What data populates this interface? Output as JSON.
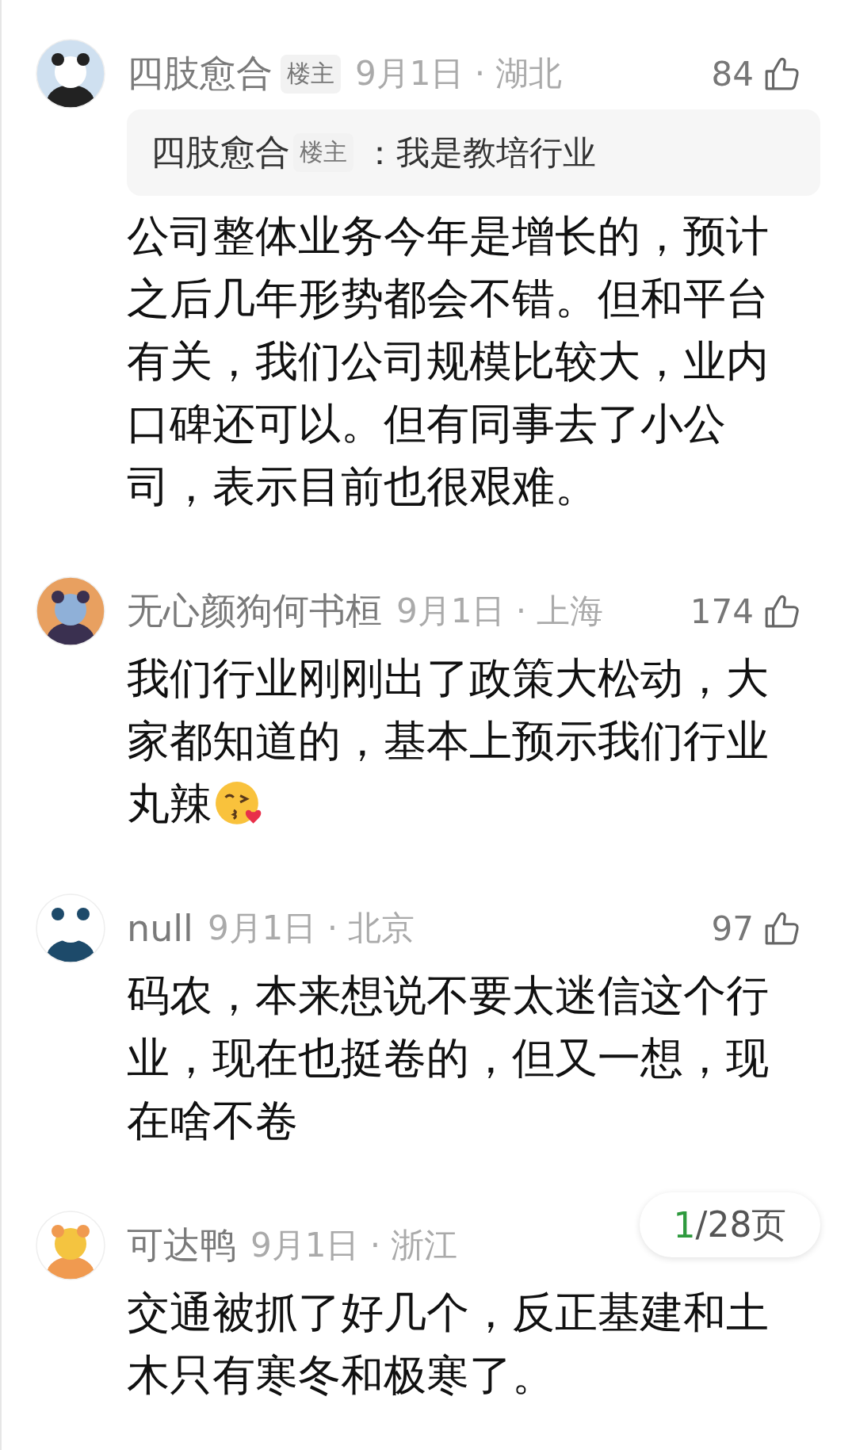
{
  "comments": [
    {
      "author": "四肢愈合",
      "badge": "楼主",
      "meta": "9月1日 · 湖北",
      "likes": "84",
      "quote": {
        "author": "四肢愈合",
        "badge": "楼主",
        "text": "：我是教培行业"
      },
      "body": "公司整体业务今年是增长的，预计之后几年形势都会不错。但和平台有关，我们公司规模比较大，业内口碑还可以。但有同事去了小公司，表示目前也很艰难。"
    },
    {
      "author": "无心颜狗何书桓",
      "meta": "9月1日 · 上海",
      "likes": "174",
      "body": "我们行业刚刚出了政策大松动，大家都知道的，基本上预示我们行业",
      "tail": {
        "text": "丸辣",
        "kind": "kissing-face"
      }
    },
    {
      "author": "null",
      "meta": "9月1日 · 北京",
      "likes": "97",
      "body": "码农，本来想说不要太迷信这个行业，现在也挺卷的，但又一想，现在啥不卷"
    },
    {
      "author": "可达鸭",
      "meta": "9月1日 · 浙江",
      "body": "交通被抓了好几个，反正基建和土木只有寒冬和极寒了。"
    }
  ],
  "pager": {
    "current": "1",
    "total": "/28页"
  }
}
